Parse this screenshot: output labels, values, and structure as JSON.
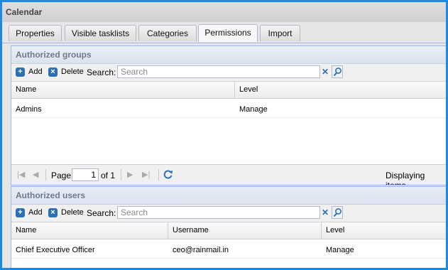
{
  "window": {
    "title": "Calendar"
  },
  "tabs": [
    "Properties",
    "Visible tasklists",
    "Categories",
    "Permissions",
    "Import"
  ],
  "active_tab": "Permissions",
  "groups_panel": {
    "title": "Authorized groups",
    "toolbar": {
      "add_label": "Add",
      "delete_label": "Delete",
      "search_label": "Search:",
      "search_placeholder": "Search"
    },
    "columns": [
      "Name",
      "Level"
    ],
    "rows": [
      {
        "name": "Admins",
        "level": "Manage"
      }
    ],
    "pager": {
      "page_label": "Page",
      "page_value": "1",
      "of_label": "of 1",
      "displaying": "Displaying items"
    }
  },
  "users_panel": {
    "title": "Authorized users",
    "toolbar": {
      "add_label": "Add",
      "delete_label": "Delete",
      "search_label": "Search:",
      "search_placeholder": "Search"
    },
    "columns": [
      "Name",
      "Username",
      "Level"
    ],
    "rows": [
      {
        "name": "Chief Executive Officer",
        "username": "ceo@rainmail.in",
        "level": "Manage"
      }
    ]
  },
  "colors": {
    "accent": "#1e88e5",
    "icon_blue": "#2c6fb5",
    "header_text": "#6d7a8a"
  },
  "icons": [
    "add-icon",
    "delete-icon",
    "clear-icon",
    "search-icon",
    "first-page-icon",
    "prev-page-icon",
    "next-page-icon",
    "last-page-icon",
    "refresh-icon"
  ]
}
